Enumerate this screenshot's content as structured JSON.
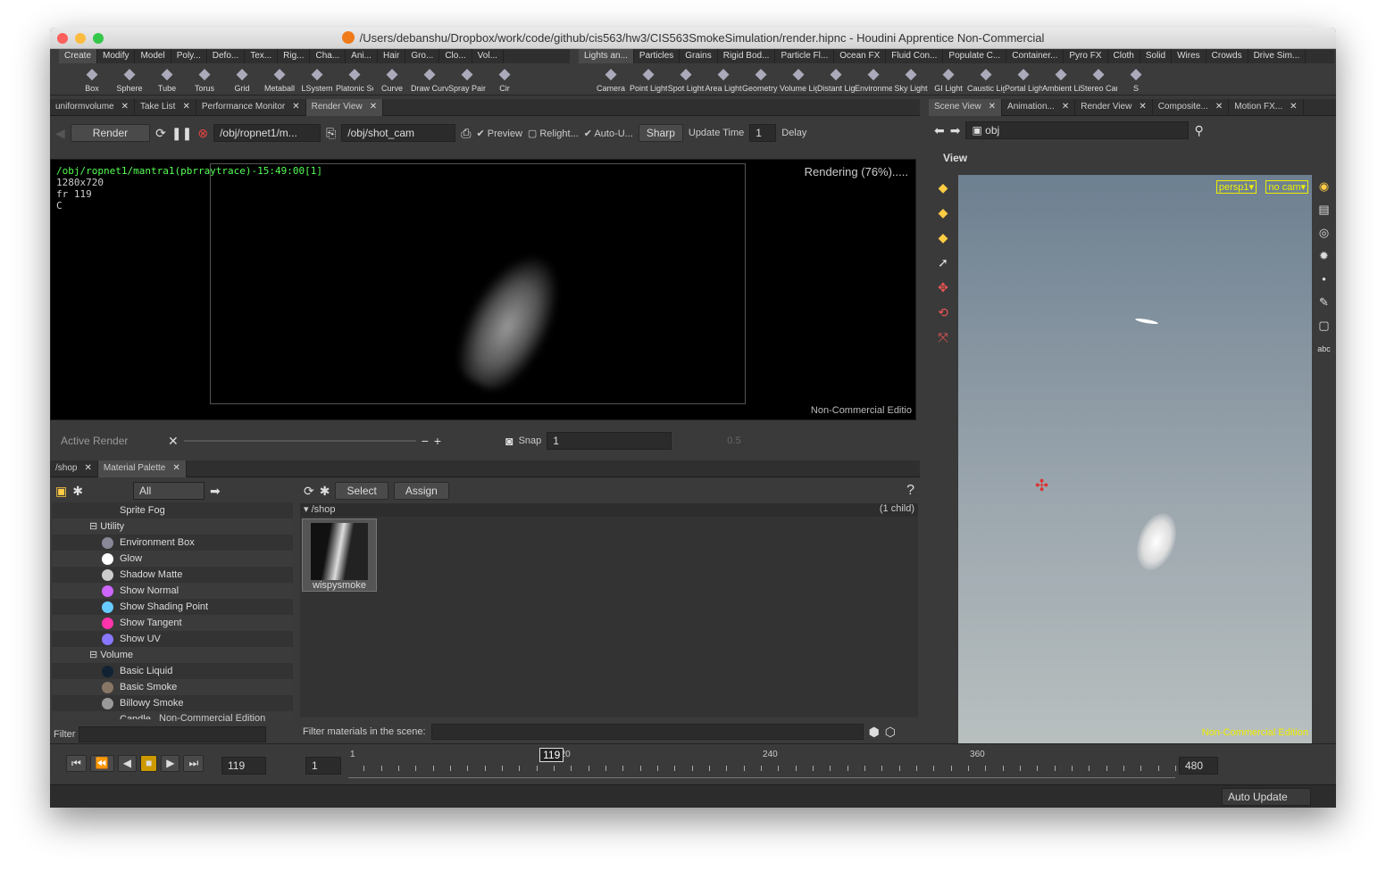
{
  "window": {
    "title": "/Users/debanshu/Dropbox/work/code/github/cis563/hw3/CIS563SmokeSimulation/render.hipnc - Houdini Apprentice Non-Commercial"
  },
  "shelf_left": {
    "tabs": [
      "Create",
      "Modify",
      "Model",
      "Poly...",
      "Defo...",
      "Tex...",
      "Rig...",
      "Cha...",
      "Ani...",
      "Hair",
      "Gro...",
      "Clo...",
      "Vol..."
    ],
    "tools": [
      "Box",
      "Sphere",
      "Tube",
      "Torus",
      "Grid",
      "Metaball",
      "LSystem",
      "Platonic Sol...",
      "Curve",
      "Draw Curve",
      "Spray Paint",
      "Cir"
    ]
  },
  "shelf_right": {
    "tabs": [
      "Lights an...",
      "Particles",
      "Grains",
      "Rigid Bod...",
      "Particle Fl...",
      "Ocean FX",
      "Fluid Con...",
      "Populate C...",
      "Container...",
      "Pyro FX",
      "Cloth",
      "Solid",
      "Wires",
      "Crowds",
      "Drive Sim..."
    ],
    "tools": [
      "Camera",
      "Point Light",
      "Spot Light",
      "Area Light",
      "Geometry L...",
      "Volume Light",
      "Distant Light",
      "Environmen...",
      "Sky Light",
      "GI Light",
      "Caustic Light",
      "Portal Light",
      "Ambient Lig...",
      "Stereo Cam...",
      "S"
    ]
  },
  "top_tabs": [
    {
      "label": "uniformvolume"
    },
    {
      "label": "Take List"
    },
    {
      "label": "Performance Monitor"
    },
    {
      "label": "Render View"
    }
  ],
  "render_toolbar": {
    "render": "Render",
    "rop": "/obj/ropnet1/m...",
    "camera": "/obj/shot_cam",
    "preview": "Preview",
    "relight": "Relight...",
    "auto_update": "Auto-U...",
    "sharp": "Sharp",
    "update_time_label": "Update Time",
    "update_time_value": "1",
    "delay": "Delay"
  },
  "render_view": {
    "path": "/obj/ropnet1/mantra1(pbrraytrace)-15:49:00[1]",
    "res": "1280x720",
    "frame": "fr 119",
    "channel": "C",
    "status": "Rendering (76%).....",
    "watermark": "Non-Commercial Editio",
    "progress": 0.76
  },
  "render_bottom": {
    "active_render": "Active Render",
    "snap_label": "Snap",
    "snap_value": "1",
    "gamma": "0.5"
  },
  "mid_tabs": [
    {
      "label": "/shop"
    },
    {
      "label": "Material Palette"
    }
  ],
  "palette": {
    "filter_all": "All",
    "select": "Select",
    "assign": "Assign",
    "shop_path": "/shop",
    "child_count": "(1 child)",
    "material": "wispysmoke",
    "filter_label": "Filter",
    "filter_scene": "Filter materials in the scene:",
    "watermark": "Non-Commercial Edition",
    "tree": [
      {
        "label": "Sprite Fog",
        "type": "item"
      },
      {
        "label": "Utility",
        "type": "group"
      },
      {
        "label": "Environment Box",
        "type": "item",
        "color": "#889"
      },
      {
        "label": "Glow",
        "type": "item",
        "color": "#fff"
      },
      {
        "label": "Shadow Matte",
        "type": "item",
        "color": "#ccc"
      },
      {
        "label": "Show Normal",
        "type": "item",
        "color": "#c6f"
      },
      {
        "label": "Show Shading Point",
        "type": "item",
        "color": "#6cf"
      },
      {
        "label": "Show Tangent",
        "type": "item",
        "color": "#f3a"
      },
      {
        "label": "Show UV",
        "type": "item",
        "color": "#87f"
      },
      {
        "label": "Volume",
        "type": "group"
      },
      {
        "label": "Basic Liquid",
        "type": "item",
        "color": "#123"
      },
      {
        "label": "Basic Smoke",
        "type": "item",
        "color": "#876"
      },
      {
        "label": "Billowy Smoke",
        "type": "item",
        "color": "#999"
      },
      {
        "label": "Candle",
        "type": "item"
      }
    ]
  },
  "scene_tabs": [
    {
      "label": "Scene View"
    },
    {
      "label": "Animation..."
    },
    {
      "label": "Render View"
    },
    {
      "label": "Composite..."
    },
    {
      "label": "Motion FX..."
    }
  ],
  "scene": {
    "path": "obj",
    "view": "View",
    "persp": "persp1▾",
    "cam": "no cam▾",
    "watermark": "Non-Commercial Edition"
  },
  "timeline": {
    "frame": "119",
    "start": "1",
    "end": "480",
    "current": "119",
    "ticks": [
      "1",
      "120",
      "240",
      "360"
    ]
  },
  "statusbar": {
    "auto_update": "Auto Update"
  }
}
